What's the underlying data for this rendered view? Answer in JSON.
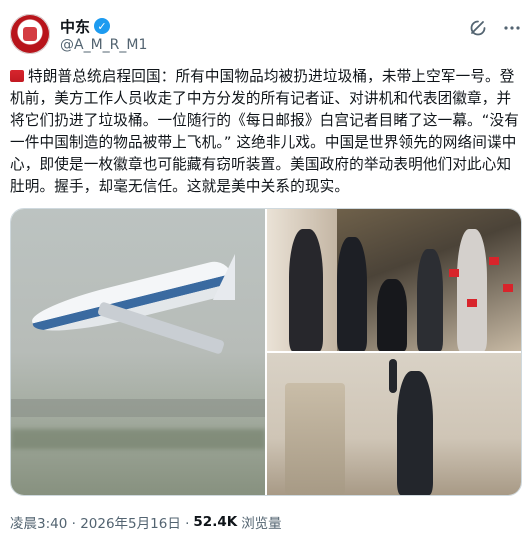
{
  "author": {
    "display_name": "中东",
    "handle": "@A_M_R_M1",
    "verified": true
  },
  "post": {
    "text": "特朗普总统启程回国：所有中国物品均被扔进垃圾桶，未带上空军一号。登机前，美方工作人员收走了中方分发的所有记者证、对讲机和代表团徽章，并将它们扔进了垃圾桶。一位随行的《每日邮报》白宫记者目睹了这一幕。“没有一件中国制造的物品被带上飞机。” 这绝非儿戏。中国是世界领先的网络间谍中心，即使是一枚徽章也可能藏有窃听装置。美国政府的举动表明他们对此心知肚明。握手，却毫无信任。这就是美中关系的现实。",
    "lead_icon": "red-flag-emoji"
  },
  "meta": {
    "timestamp": "凌晨3:40 · 2026年5月16日 · ",
    "views_count": "52.4K",
    "views_label": "浏览量"
  },
  "icons": {
    "grok": "grok-icon",
    "more": "more-icon"
  },
  "colors": {
    "verified": "#1d9bf0",
    "text": "#0f1419",
    "muted": "#536471"
  }
}
